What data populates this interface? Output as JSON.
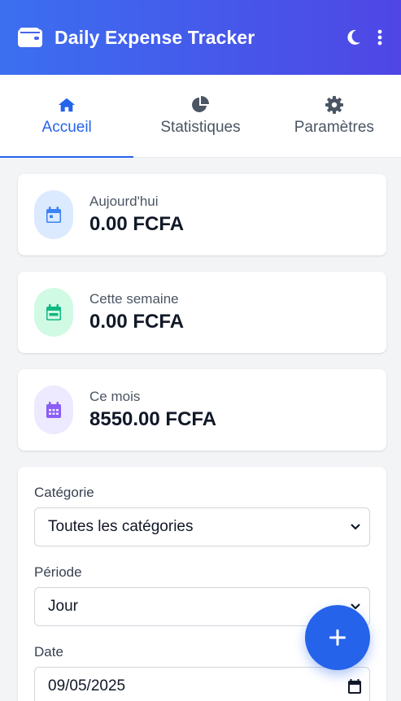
{
  "app": {
    "title": "Daily Expense Tracker"
  },
  "header": {
    "icons": [
      "wallet-icon",
      "moon-icon",
      "more-vertical-icon"
    ]
  },
  "tabs": [
    {
      "label": "Accueil",
      "icon": "home-icon",
      "active": true
    },
    {
      "label": "Statistiques",
      "icon": "pie-chart-icon",
      "active": false
    },
    {
      "label": "Paramètres",
      "icon": "gear-icon",
      "active": false
    }
  ],
  "stats": [
    {
      "label": "Aujourd'hui",
      "value": "0.00 FCFA",
      "icon": "calendar-day-icon",
      "color": "#3b82f6",
      "bg": "#dbeafe"
    },
    {
      "label": "Cette semaine",
      "value": "0.00 FCFA",
      "icon": "calendar-week-icon",
      "color": "#10b981",
      "bg": "#d1fae5"
    },
    {
      "label": "Ce mois",
      "value": "8550.00 FCFA",
      "icon": "calendar-month-icon",
      "color": "#8b5cf6",
      "bg": "#ede9fe"
    }
  ],
  "filters": {
    "category": {
      "label": "Catégorie",
      "value": "Toutes les catégories"
    },
    "period": {
      "label": "Période",
      "value": "Jour"
    },
    "date": {
      "label": "Date",
      "value": "09/05/2025"
    }
  },
  "fab": {
    "icon": "plus-icon"
  },
  "colors": {
    "header_start": "#3b6ff0",
    "header_end": "#4f46e5",
    "accent": "#2563eb"
  }
}
